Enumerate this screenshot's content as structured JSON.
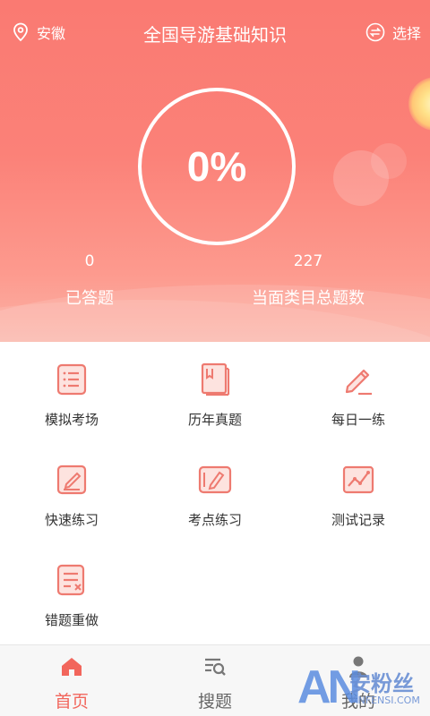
{
  "header": {
    "location": "安徽",
    "title": "全国导游基础知识",
    "choose_label": "选择",
    "progress_percent": "0%"
  },
  "stats": {
    "answered_value": "0",
    "answered_label": "已答题",
    "total_value": "227",
    "total_label": "当面类目总题数"
  },
  "menu": [
    {
      "label": "模拟考场",
      "icon": "list-document-icon"
    },
    {
      "label": "历年真题",
      "icon": "book-icon"
    },
    {
      "label": "每日一练",
      "icon": "pencil-icon"
    },
    {
      "label": "快速练习",
      "icon": "edit-document-icon"
    },
    {
      "label": "考点练习",
      "icon": "tablet-pen-icon"
    },
    {
      "label": "测试记录",
      "icon": "chart-line-icon"
    },
    {
      "label": "错题重做",
      "icon": "error-document-icon"
    }
  ],
  "tabs": [
    {
      "label": "首页",
      "icon": "home-icon"
    },
    {
      "label": "搜题",
      "icon": "search-list-icon"
    },
    {
      "label": "我的",
      "icon": "user-icon"
    }
  ],
  "watermark": {
    "logo": "AN",
    "cn": "安粉丝",
    "en": "ANFENSI.COM"
  },
  "colors": {
    "accent": "#f2665c",
    "hero_top": "#fa7a72",
    "hero_bottom": "#fbb2a6",
    "icon_stroke": "#ee7a70",
    "icon_fill": "#fde3df"
  }
}
